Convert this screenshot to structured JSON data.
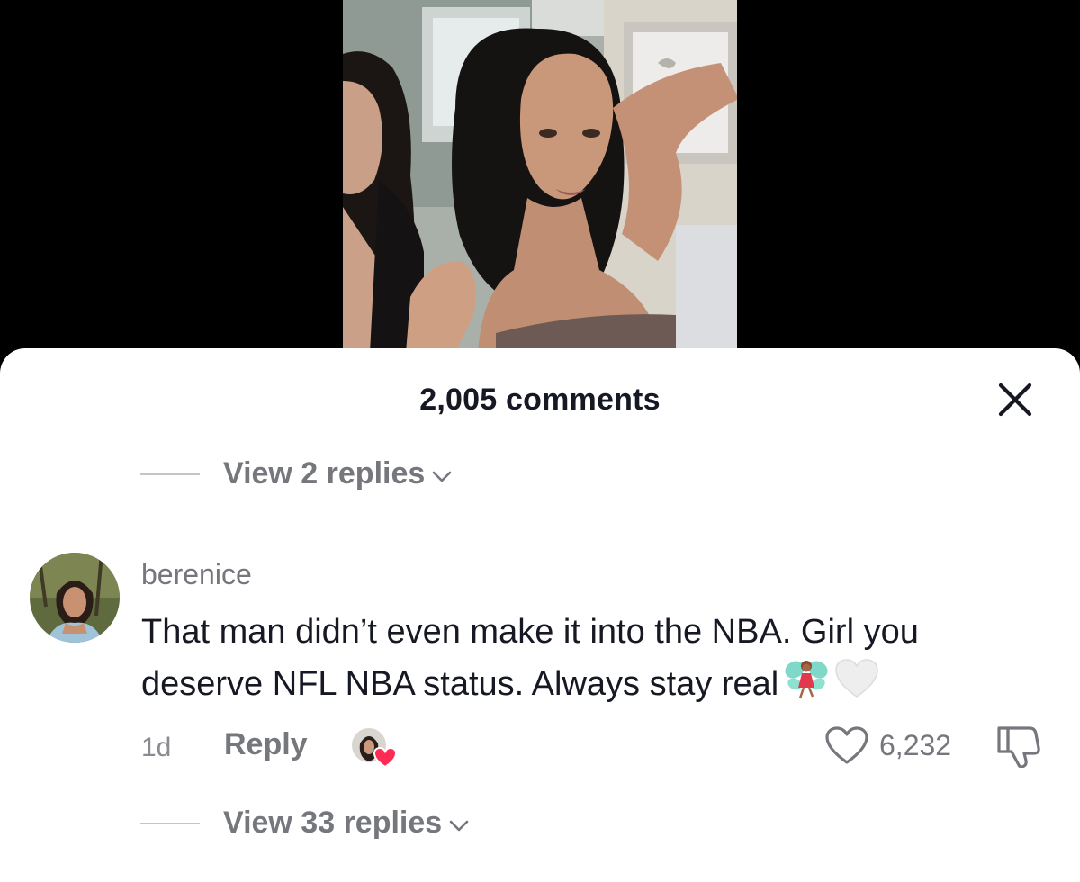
{
  "sheet": {
    "title": "2,005 comments",
    "close_icon": "close-icon"
  },
  "thread": {
    "view_replies_top": "View 2 replies",
    "view_replies_bottom": "View 33 replies"
  },
  "comment": {
    "username": "berenice",
    "text_line1": "That man didn’t even make it into the NBA. Girl you",
    "text_line2": "deserve NFL NBA status. Always stay real",
    "emojis": [
      "fairy-emoji",
      "white-heart-emoji"
    ],
    "time": "1d",
    "reply_label": "Reply",
    "like_count": "6,232",
    "icons": [
      "heart-outline-icon",
      "dislike-icon",
      "creator-liked-badge"
    ]
  },
  "colors": {
    "text_primary": "#161823",
    "text_secondary": "#75777d",
    "creator_heart": "#fe2c55",
    "background": "#ffffff"
  }
}
